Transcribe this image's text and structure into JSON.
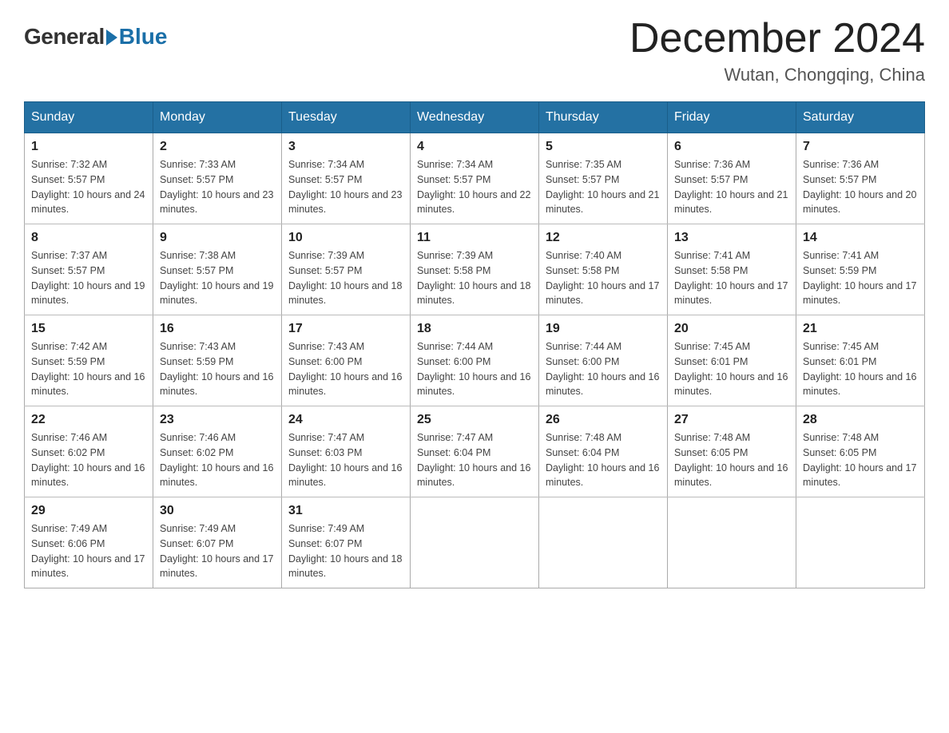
{
  "logo": {
    "general": "General",
    "blue": "Blue"
  },
  "title": {
    "month_year": "December 2024",
    "location": "Wutan, Chongqing, China"
  },
  "weekdays": [
    "Sunday",
    "Monday",
    "Tuesday",
    "Wednesday",
    "Thursday",
    "Friday",
    "Saturday"
  ],
  "weeks": [
    [
      {
        "day": "1",
        "sunrise": "7:32 AM",
        "sunset": "5:57 PM",
        "daylight": "10 hours and 24 minutes."
      },
      {
        "day": "2",
        "sunrise": "7:33 AM",
        "sunset": "5:57 PM",
        "daylight": "10 hours and 23 minutes."
      },
      {
        "day": "3",
        "sunrise": "7:34 AM",
        "sunset": "5:57 PM",
        "daylight": "10 hours and 23 minutes."
      },
      {
        "day": "4",
        "sunrise": "7:34 AM",
        "sunset": "5:57 PM",
        "daylight": "10 hours and 22 minutes."
      },
      {
        "day": "5",
        "sunrise": "7:35 AM",
        "sunset": "5:57 PM",
        "daylight": "10 hours and 21 minutes."
      },
      {
        "day": "6",
        "sunrise": "7:36 AM",
        "sunset": "5:57 PM",
        "daylight": "10 hours and 21 minutes."
      },
      {
        "day": "7",
        "sunrise": "7:36 AM",
        "sunset": "5:57 PM",
        "daylight": "10 hours and 20 minutes."
      }
    ],
    [
      {
        "day": "8",
        "sunrise": "7:37 AM",
        "sunset": "5:57 PM",
        "daylight": "10 hours and 19 minutes."
      },
      {
        "day": "9",
        "sunrise": "7:38 AM",
        "sunset": "5:57 PM",
        "daylight": "10 hours and 19 minutes."
      },
      {
        "day": "10",
        "sunrise": "7:39 AM",
        "sunset": "5:57 PM",
        "daylight": "10 hours and 18 minutes."
      },
      {
        "day": "11",
        "sunrise": "7:39 AM",
        "sunset": "5:58 PM",
        "daylight": "10 hours and 18 minutes."
      },
      {
        "day": "12",
        "sunrise": "7:40 AM",
        "sunset": "5:58 PM",
        "daylight": "10 hours and 17 minutes."
      },
      {
        "day": "13",
        "sunrise": "7:41 AM",
        "sunset": "5:58 PM",
        "daylight": "10 hours and 17 minutes."
      },
      {
        "day": "14",
        "sunrise": "7:41 AM",
        "sunset": "5:59 PM",
        "daylight": "10 hours and 17 minutes."
      }
    ],
    [
      {
        "day": "15",
        "sunrise": "7:42 AM",
        "sunset": "5:59 PM",
        "daylight": "10 hours and 16 minutes."
      },
      {
        "day": "16",
        "sunrise": "7:43 AM",
        "sunset": "5:59 PM",
        "daylight": "10 hours and 16 minutes."
      },
      {
        "day": "17",
        "sunrise": "7:43 AM",
        "sunset": "6:00 PM",
        "daylight": "10 hours and 16 minutes."
      },
      {
        "day": "18",
        "sunrise": "7:44 AM",
        "sunset": "6:00 PM",
        "daylight": "10 hours and 16 minutes."
      },
      {
        "day": "19",
        "sunrise": "7:44 AM",
        "sunset": "6:00 PM",
        "daylight": "10 hours and 16 minutes."
      },
      {
        "day": "20",
        "sunrise": "7:45 AM",
        "sunset": "6:01 PM",
        "daylight": "10 hours and 16 minutes."
      },
      {
        "day": "21",
        "sunrise": "7:45 AM",
        "sunset": "6:01 PM",
        "daylight": "10 hours and 16 minutes."
      }
    ],
    [
      {
        "day": "22",
        "sunrise": "7:46 AM",
        "sunset": "6:02 PM",
        "daylight": "10 hours and 16 minutes."
      },
      {
        "day": "23",
        "sunrise": "7:46 AM",
        "sunset": "6:02 PM",
        "daylight": "10 hours and 16 minutes."
      },
      {
        "day": "24",
        "sunrise": "7:47 AM",
        "sunset": "6:03 PM",
        "daylight": "10 hours and 16 minutes."
      },
      {
        "day": "25",
        "sunrise": "7:47 AM",
        "sunset": "6:04 PM",
        "daylight": "10 hours and 16 minutes."
      },
      {
        "day": "26",
        "sunrise": "7:48 AM",
        "sunset": "6:04 PM",
        "daylight": "10 hours and 16 minutes."
      },
      {
        "day": "27",
        "sunrise": "7:48 AM",
        "sunset": "6:05 PM",
        "daylight": "10 hours and 16 minutes."
      },
      {
        "day": "28",
        "sunrise": "7:48 AM",
        "sunset": "6:05 PM",
        "daylight": "10 hours and 17 minutes."
      }
    ],
    [
      {
        "day": "29",
        "sunrise": "7:49 AM",
        "sunset": "6:06 PM",
        "daylight": "10 hours and 17 minutes."
      },
      {
        "day": "30",
        "sunrise": "7:49 AM",
        "sunset": "6:07 PM",
        "daylight": "10 hours and 17 minutes."
      },
      {
        "day": "31",
        "sunrise": "7:49 AM",
        "sunset": "6:07 PM",
        "daylight": "10 hours and 18 minutes."
      },
      null,
      null,
      null,
      null
    ]
  ],
  "labels": {
    "sunrise": "Sunrise:",
    "sunset": "Sunset:",
    "daylight": "Daylight:"
  }
}
